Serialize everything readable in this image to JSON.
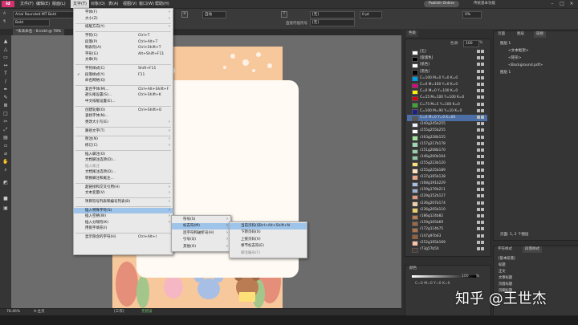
{
  "menubar": {
    "logo": "Id",
    "items": [
      "文件(F)",
      "编辑(E)",
      "版面(L)",
      "文字(T)",
      "对象(O)",
      "表(A)",
      "视图(V)",
      "窗口(W)",
      "帮助(H)"
    ],
    "publish": "Publish Online",
    "workspace": "传统基本功能"
  },
  "controlbar": {
    "font": "Arial Rounded MT Bold",
    "style": "Bold",
    "char_style": "[无]",
    "para_style_label": "[无]",
    "auto": "自动",
    "checkbox_label": "直接内插符号",
    "size": "0 pt",
    "zoom": "0%"
  },
  "doc_tab": "*未未命名 - 8.indd @ 78%",
  "text_menu": {
    "items": [
      {
        "label": "字体(F)",
        "shortcut": "",
        "arrow": true
      },
      {
        "label": "大小(Z)",
        "shortcut": "",
        "arrow": true
      },
      {
        "sep": true
      },
      {
        "label": "排版方向(Y)",
        "shortcut": "",
        "arrow": true
      },
      {
        "sep": true
      },
      {
        "label": "字符(C)",
        "shortcut": "Ctrl+T"
      },
      {
        "label": "段落(P)",
        "shortcut": "Ctrl+Alt+T"
      },
      {
        "label": "制表符(A)",
        "shortcut": "Ctrl+Shift+T"
      },
      {
        "label": "字形(G)",
        "shortcut": "Alt+Shift+F11"
      },
      {
        "label": "文章(R)",
        "shortcut": ""
      },
      {
        "sep": true
      },
      {
        "label": "字符样式(C)",
        "shortcut": "Shift+F11"
      },
      {
        "label": "段落样式(Y)",
        "shortcut": "F11",
        "check": true
      },
      {
        "label": "命名网格(Q)",
        "shortcut": ""
      },
      {
        "sep": true
      },
      {
        "label": "复合字体(M)...",
        "shortcut": "Ctrl+Alt+Shift+F"
      },
      {
        "label": "避头尾设置(S)...",
        "shortcut": "Ctrl+Shift+K"
      },
      {
        "label": "中文排版设置(E)...",
        "shortcut": ""
      },
      {
        "sep": true
      },
      {
        "label": "创建轮廓(O)",
        "shortcut": "Ctrl+Shift+O"
      },
      {
        "label": "查找字体(N)...",
        "shortcut": ""
      },
      {
        "label": "更改大小写(E)",
        "shortcut": "",
        "arrow": true
      },
      {
        "sep": true
      },
      {
        "label": "路径文字(T)",
        "shortcut": "",
        "arrow": true
      },
      {
        "sep": true
      },
      {
        "label": "附注(N)",
        "shortcut": "",
        "arrow": true
      },
      {
        "label": "修订(C)",
        "shortcut": "",
        "arrow": true
      },
      {
        "sep": true
      },
      {
        "label": "插入脚注(O)",
        "shortcut": ""
      },
      {
        "label": "文档脚注选项(D)...",
        "shortcut": ""
      },
      {
        "label": "插入尾注",
        "shortcut": "",
        "disabled": true
      },
      {
        "label": "文档尾注选项(D)...",
        "shortcut": ""
      },
      {
        "label": "转换脚注和尾注...",
        "shortcut": ""
      },
      {
        "sep": true
      },
      {
        "label": "超链接和交叉引用(H)",
        "shortcut": "",
        "arrow": true
      },
      {
        "label": "文本变量(V)",
        "shortcut": "",
        "arrow": true
      },
      {
        "sep": true
      },
      {
        "label": "项目符号列表和编号列表(B)",
        "shortcut": "",
        "arrow": true
      },
      {
        "sep": true
      },
      {
        "label": "插入特殊字符(S)",
        "shortcut": "",
        "arrow": true,
        "highlight": true
      },
      {
        "label": "插入空格(W)",
        "shortcut": "",
        "arrow": true
      },
      {
        "label": "插入分隔符(K)",
        "shortcut": "",
        "arrow": true
      },
      {
        "label": "用假字填充(I)",
        "shortcut": ""
      },
      {
        "sep": true
      },
      {
        "label": "显示隐含的字符(H)",
        "shortcut": "Ctrl+Alt+I"
      }
    ]
  },
  "special_menu": {
    "items": [
      {
        "label": "符号(S)",
        "arrow": true
      },
      {
        "label": "标志符(M)",
        "arrow": true,
        "highlight": true
      },
      {
        "label": "连字符和破折号(H)",
        "arrow": true
      },
      {
        "label": "引号(Q)",
        "arrow": true
      },
      {
        "label": "其他(O)",
        "arrow": true
      }
    ]
  },
  "marker_menu": {
    "items": [
      {
        "label": "当前页码(C)",
        "shortcut": "Ctrl+Alt+Shift+N",
        "highlight": true
      },
      {
        "label": "下转页码(X)",
        "shortcut": ""
      },
      {
        "label": "上接页码(V)",
        "shortcut": ""
      },
      {
        "label": "章节标志符(E)",
        "shortcut": ""
      },
      {
        "label": "脚注编号(F)",
        "shortcut": "",
        "disabled": true
      }
    ]
  },
  "swatches": {
    "tab": "色板",
    "tint_label": "色调:",
    "tint": "100",
    "tint_unit": "%",
    "items": [
      {
        "name": "[无]",
        "color": "#ffffff"
      },
      {
        "name": "[套版色]",
        "color": "#000000"
      },
      {
        "name": "[纸色]",
        "color": "#ffffff"
      },
      {
        "name": "[黑色]",
        "color": "#000000"
      },
      {
        "name": "C=100 M=0 Y=0 K=0",
        "color": "#00a0e9"
      },
      {
        "name": "C=0 M=100 Y=0 K=0",
        "color": "#e4007f"
      },
      {
        "name": "C=0 M=0 Y=100 K=0",
        "color": "#fff100"
      },
      {
        "name": "C=15 M=100 Y=100 K=0",
        "color": "#d7000f"
      },
      {
        "name": "C=75 M=5 Y=100 K=0",
        "color": "#3fa535"
      },
      {
        "name": "C=100 M=90 Y=10 K=0",
        "color": "#1d2088"
      },
      {
        "name": "C=0 M=0 Y=0 K=80",
        "color": "#595757",
        "selected": true
      },
      {
        "name": "r240g245b255",
        "color": "#f0f5ff"
      },
      {
        "name": "r255g255b255",
        "color": "#ffffff"
      },
      {
        "name": "r163g228b155",
        "color": "#a3e49b"
      },
      {
        "name": "r157g217b178",
        "color": "#9dd9b2"
      },
      {
        "name": "r151g208b170",
        "color": "#97d0aa"
      },
      {
        "name": "r146g200b164",
        "color": "#92c8a4"
      },
      {
        "name": "r255g223b120",
        "color": "#ffdf78"
      },
      {
        "name": "r255g225b189",
        "color": "#ffe1bd"
      },
      {
        "name": "r237g165b138",
        "color": "#eda58a"
      },
      {
        "name": "r168g191b229",
        "color": "#a8bfe5"
      },
      {
        "name": "r159g176b211",
        "color": "#9fb0d3"
      },
      {
        "name": "r229g152b127",
        "color": "#e5987f"
      },
      {
        "name": "r236g207b174",
        "color": "#eccfae"
      },
      {
        "name": "r236g205b110",
        "color": "#eccd6e"
      },
      {
        "name": "r186g124b82",
        "color": "#ba7c52"
      },
      {
        "name": "r159g105b69",
        "color": "#9f6945"
      },
      {
        "name": "r172g114b75",
        "color": "#ac724b"
      },
      {
        "name": "r147g97b63",
        "color": "#93613f"
      },
      {
        "name": "r252g195b169",
        "color": "#fcc3a9"
      },
      {
        "name": "r73g57b50",
        "color": "#493932"
      }
    ]
  },
  "layers": {
    "tabs": [
      "页面",
      "图层",
      "链接"
    ],
    "items": [
      "图层 1",
      "<文本框架>",
      "<矩形>",
      "<Background.pdf>",
      "图层 1"
    ],
    "footer": "页面: 1, 2 个图层"
  },
  "char_panel": {
    "tab": "颜色",
    "tint": "100",
    "unit": "%",
    "value": "C=0 M=0 Y=0 K=0"
  },
  "para_panel": {
    "tabs": [
      "字符样式",
      "段落样式"
    ],
    "items": [
      "[基本段落]",
      "标题",
      "正文",
      "文章标题",
      "页眉标题",
      "页脚标题"
    ]
  },
  "statusbar": {
    "zoom": "78.46%",
    "page": "A-主页",
    "state": "[工作]",
    "errors": "无错误"
  },
  "watermark": "知乎 @王世杰"
}
